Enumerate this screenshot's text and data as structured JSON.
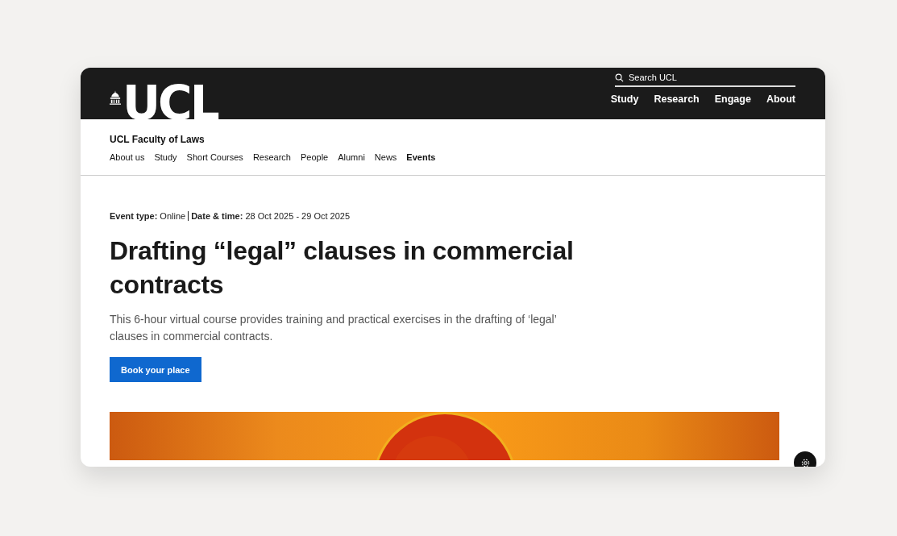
{
  "header": {
    "logo": "UCL",
    "search": {
      "placeholder": "Search UCL"
    },
    "nav": [
      "Study",
      "Research",
      "Engage",
      "About"
    ]
  },
  "faculty": {
    "title": "UCL Faculty of Laws",
    "nav": [
      {
        "label": "About us",
        "selected": false
      },
      {
        "label": "Study",
        "selected": false
      },
      {
        "label": "Short Courses",
        "selected": false
      },
      {
        "label": "Research",
        "selected": false
      },
      {
        "label": "People",
        "selected": false
      },
      {
        "label": "Alumni",
        "selected": false
      },
      {
        "label": "News",
        "selected": false
      },
      {
        "label": "Events",
        "selected": true
      }
    ]
  },
  "event": {
    "meta": [
      {
        "label": "Event type:",
        "value": "Online"
      },
      {
        "label": "Date & time:",
        "value": "28 Oct 2025 - 29 Oct 2025"
      }
    ],
    "title": "Drafting “legal” clauses in commercial contracts",
    "description": "This 6-hour virtual course provides training and practical exercises in the drafting of ‘legal’ clauses in commercial contracts.",
    "button": "Book your place"
  }
}
